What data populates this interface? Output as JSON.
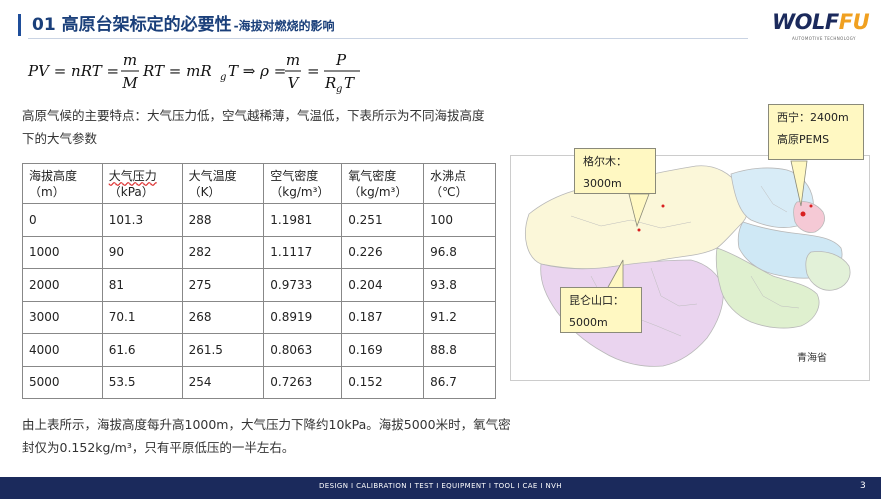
{
  "header": {
    "title": "01 高原台架标定的必要性",
    "subtitle": "-海拔对燃烧的影响"
  },
  "logo": {
    "brand_main": "WOLF",
    "brand_accent": "FU",
    "tagline": "AUTOMOTIVE TECHNOLOGY"
  },
  "formula": {
    "lhs": "PV = nRT =",
    "frac1_num": "m",
    "frac1_den": "M",
    "mid": "RT = mR",
    "mid_sub": "g",
    "mid2": "T ⇒ ρ =",
    "frac2_num": "m",
    "frac2_den": "V",
    "eq": "=",
    "frac3_num": "P",
    "frac3_den": "R",
    "frac3_den_sub": "g",
    "frac3_den_tail": "T"
  },
  "intro": "高原气候的主要特点：大气压力低，空气越稀薄，气温低，下表所示为不同海拔高度下的大气参数",
  "table": {
    "headers": [
      {
        "line1": "海拔高度",
        "line2": "（m）"
      },
      {
        "line1": "大气压力",
        "line2": "（kPa）"
      },
      {
        "line1": "大气温度",
        "line2": "（K）"
      },
      {
        "line1": "空气密度",
        "line2": "（kg/m³）"
      },
      {
        "line1": "氧气密度",
        "line2": "（kg/m³）"
      },
      {
        "line1": "水沸点",
        "line2": "（℃）"
      }
    ],
    "rows": [
      [
        "0",
        "101.3",
        "288",
        "1.1981",
        "0.251",
        "100"
      ],
      [
        "1000",
        "90",
        "282",
        "1.1117",
        "0.226",
        "96.8"
      ],
      [
        "2000",
        "81",
        "275",
        "0.9733",
        "0.204",
        "93.8"
      ],
      [
        "3000",
        "70.1",
        "268",
        "0.8919",
        "0.187",
        "91.2"
      ],
      [
        "4000",
        "61.6",
        "261.5",
        "0.8063",
        "0.169",
        "88.8"
      ],
      [
        "5000",
        "53.5",
        "254",
        "0.7263",
        "0.152",
        "86.7"
      ]
    ]
  },
  "conclusion": "由上表所示，海拔高度每升高1000m，大气压力下降约10kPa。海拔5000米时，氧气密封仅为0.152kg/m³，只有平原低压的一半左右。",
  "map": {
    "province": "青海省",
    "callouts": {
      "xining_line1": "西宁：2400m",
      "xining_line2": "高原PEMS",
      "geermu_line1": "格尔木：",
      "geermu_line2": "3000m",
      "kunlun_line1": "昆仑山口：",
      "kunlun_line2": "5000m"
    }
  },
  "footer": {
    "tagline": "DESIGN I CALIBRATION I TEST I EQUIPMENT I TOOL I CAE I NVH",
    "page": "3"
  },
  "colors": {
    "title": "#1a3f7a",
    "footer_bg": "#1b2a5c",
    "callout_bg": "#fff8c2",
    "logo_accent": "#f0a020"
  }
}
